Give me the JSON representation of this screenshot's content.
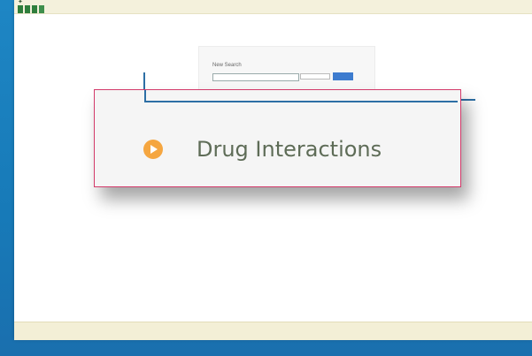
{
  "header": {
    "nav_tabs": [
      "",
      "",
      "",
      ""
    ],
    "top_links": [
      "",
      ""
    ]
  },
  "search": {
    "label": "New Search",
    "input_value": "",
    "scope_select": "",
    "button_label": ""
  },
  "callout": {
    "label": "Drug Interactions"
  },
  "footer": {
    "line1": "",
    "line2": ""
  },
  "colors": {
    "background_blue": "#1b7bb8",
    "nav_green": "#2f7e3c",
    "callout_border": "#d33a6a",
    "play_icon_orange": "#f5a640",
    "callout_text": "#5e6c57",
    "search_button_blue": "#3d7ccf"
  }
}
